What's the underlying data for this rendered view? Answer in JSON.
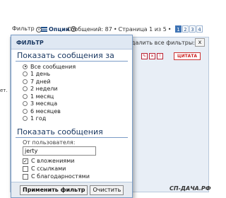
{
  "topbar": {
    "filter_label": "Фильтр",
    "options_label": "Опции",
    "messages_count": "Сообщений: 87",
    "separator": "•",
    "page_info": "Страница 1 из 5",
    "pages": [
      "1",
      "2",
      "3",
      "4"
    ]
  },
  "background": {
    "remove_filters_label": "далить все фильтры:",
    "remove_x": "x",
    "quote_label": "ЦИТАТА",
    "side_text": "ет.",
    "brand": "СП-ДАЧА.РФ"
  },
  "popup": {
    "header": "ФИЛЬТР",
    "period_title": "Показать сообщения за",
    "period_options": [
      {
        "label": "Все сообщения",
        "checked": true
      },
      {
        "label": "1 день",
        "checked": false
      },
      {
        "label": "7 дней",
        "checked": false
      },
      {
        "label": "2 недели",
        "checked": false
      },
      {
        "label": "1 месяц",
        "checked": false
      },
      {
        "label": "3 месяца",
        "checked": false
      },
      {
        "label": "6 месяцев",
        "checked": false
      },
      {
        "label": "1 год",
        "checked": false
      }
    ],
    "show_title": "Показать сообщения",
    "from_user_label": "От пользователя:",
    "from_user_value": "jerty",
    "check_options": [
      {
        "label": "С вложениями",
        "checked": true
      },
      {
        "label": "С ссылками",
        "checked": false
      },
      {
        "label": "С благодарностями",
        "checked": false
      }
    ],
    "apply_button": "Применить фильтр",
    "clear_button": "Очистить"
  },
  "colors": {
    "accent": "#1c3a63",
    "pager_active": "#3f74b5",
    "popup_border": "#7a9cc6"
  }
}
